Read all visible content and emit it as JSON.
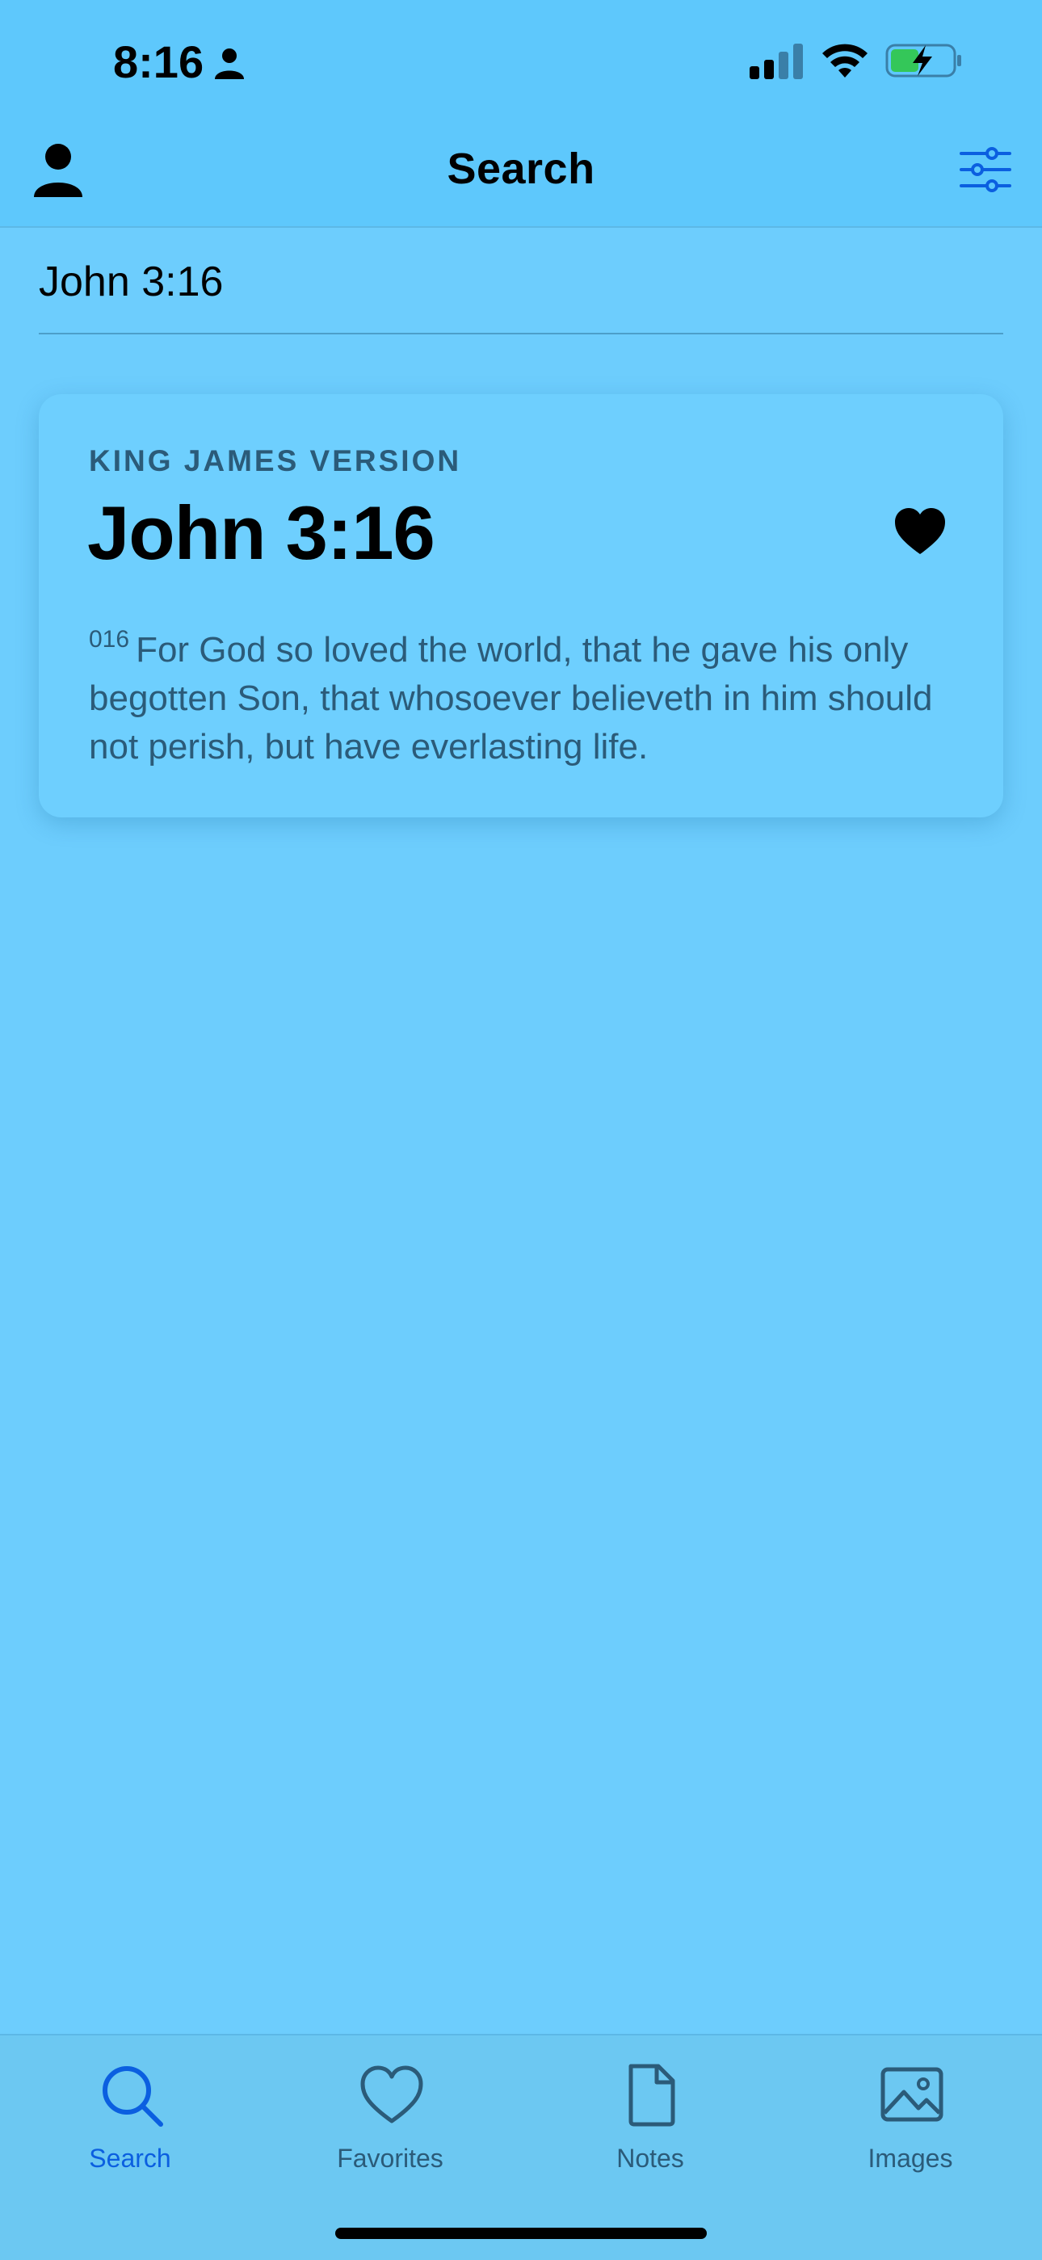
{
  "status_bar": {
    "time": "8:16"
  },
  "nav": {
    "title": "Search"
  },
  "search": {
    "value": "John 3:16"
  },
  "result_card": {
    "version": "KING JAMES VERSION",
    "reference": "John 3:16",
    "verse_number": "016",
    "verse_text": "For God so loved the world, that he gave his only begotten Son, that whosoever believeth in him should not perish, but have everlasting life.",
    "favorited": true
  },
  "tabs": [
    {
      "label": "Search",
      "icon": "search-icon",
      "active": true
    },
    {
      "label": "Favorites",
      "icon": "heart-outline-icon",
      "active": false
    },
    {
      "label": "Notes",
      "icon": "document-icon",
      "active": false
    },
    {
      "label": "Images",
      "icon": "image-icon",
      "active": false
    }
  ],
  "colors": {
    "background": "#6dcdfd",
    "header": "#5ec8fc",
    "accent": "#0b5fe0",
    "muted_text": "#2b5b79"
  }
}
